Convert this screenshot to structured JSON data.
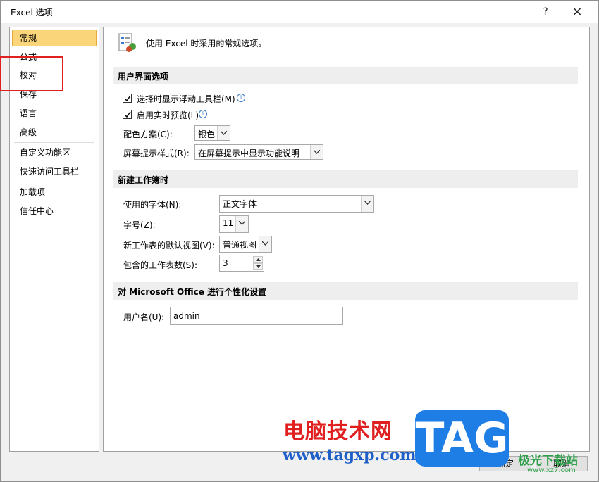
{
  "window": {
    "title": "Excel 选项",
    "help": "?",
    "close": "×"
  },
  "nav": {
    "items": [
      {
        "label": "常规"
      },
      {
        "label": "公式"
      },
      {
        "label": "校对"
      },
      {
        "label": "保存"
      },
      {
        "label": "语言"
      },
      {
        "label": "高级"
      },
      {
        "label": "自定义功能区"
      },
      {
        "label": "快速访问工具栏"
      },
      {
        "label": "加载项"
      },
      {
        "label": "信任中心"
      }
    ],
    "selected": "常规"
  },
  "header": {
    "text": "使用 Excel 时采用的常规选项。"
  },
  "ui_options": {
    "heading": "用户界面选项",
    "show_mini_toolbar": {
      "label": "选择时显示浮动工具栏(M)",
      "checked": true
    },
    "live_preview": {
      "label": "启用实时预览(L)",
      "checked": true
    },
    "color_scheme": {
      "label": "配色方案(C):",
      "value": "银色"
    },
    "screentip_style": {
      "label": "屏幕提示样式(R):",
      "value": "在屏幕提示中显示功能说明"
    }
  },
  "new_workbook": {
    "heading": "新建工作簿时",
    "font": {
      "label": "使用的字体(N):",
      "value": "正文字体"
    },
    "font_size": {
      "label": "字号(Z):",
      "value": "11"
    },
    "default_view": {
      "label": "新工作表的默认视图(V):",
      "value": "普通视图"
    },
    "sheet_count": {
      "label": "包含的工作表数(S):",
      "value": "3"
    }
  },
  "personalize": {
    "heading": "对 Microsoft Office 进行个性化设置",
    "username": {
      "label": "用户名(U):",
      "value": "admin"
    }
  },
  "buttons": {
    "ok": "确定",
    "cancel": "取消"
  },
  "watermark": {
    "cn_text": "电脑技术网",
    "url": "www.tagxp.com",
    "tag": "TAG",
    "site": "极光下载站",
    "site_url": "www.xz7.com"
  },
  "colors": {
    "selected_nav": "#fbd57a",
    "highlight_box": "#e0201e",
    "section_bg": "#eeeeee"
  }
}
